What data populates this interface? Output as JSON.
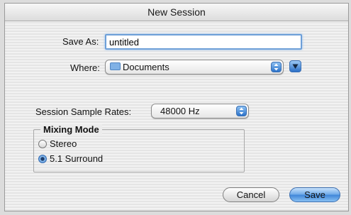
{
  "dialog": {
    "title": "New Session"
  },
  "save_as": {
    "label": "Save As:",
    "value": "untitled"
  },
  "where": {
    "label": "Where:",
    "value": "Documents",
    "icon": "folder-icon"
  },
  "sample_rate": {
    "label": "Session Sample Rates:",
    "value": "48000 Hz"
  },
  "mixing_mode": {
    "title": "Mixing Mode",
    "options": [
      {
        "label": "Stereo",
        "selected": false
      },
      {
        "label": "5.1 Surround",
        "selected": true
      }
    ]
  },
  "buttons": {
    "cancel": "Cancel",
    "save": "Save"
  },
  "colors": {
    "accent": "#3f86d8",
    "focus_ring": "#6d9fd8"
  }
}
